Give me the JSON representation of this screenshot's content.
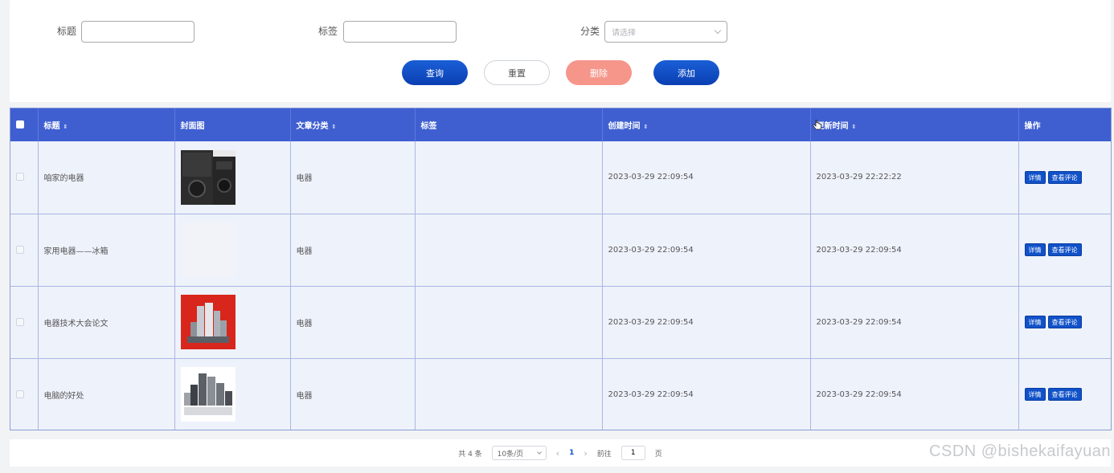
{
  "search": {
    "title_label": "标题",
    "title_value": "",
    "tag_label": "标签",
    "tag_value": "",
    "category_label": "分类",
    "category_placeholder": "请选择",
    "query_button": "查询",
    "reset_button": "重置",
    "delete_button": "删除",
    "add_button": "添加"
  },
  "table": {
    "columns": [
      "标题",
      "封面图",
      "文章分类",
      "标签",
      "创建时间",
      "更新时间",
      "操作"
    ],
    "rows": [
      {
        "title": "咱家的电器",
        "category": "电器",
        "tag": "",
        "created": "2023-03-29 22:09:54",
        "updated": "2023-03-29 22:22:22",
        "cover": "dark-appliance"
      },
      {
        "title": "家用电器——冰箱",
        "category": "电器",
        "tag": "",
        "created": "2023-03-29 22:09:54",
        "updated": "2023-03-29 22:09:54",
        "cover": "blank"
      },
      {
        "title": "电器技术大会论文",
        "category": "电器",
        "tag": "",
        "created": "2023-03-29 22:09:54",
        "updated": "2023-03-29 22:09:54",
        "cover": "red-appliances"
      },
      {
        "title": "电脑的好处",
        "category": "电器",
        "tag": "",
        "created": "2023-03-29 22:09:54",
        "updated": "2023-03-29 22:09:54",
        "cover": "grey-appliances"
      }
    ],
    "detail_button": "详情",
    "comments_button": "查看评论"
  },
  "pagination": {
    "total": "共 4 条",
    "page_size": "10条/页",
    "prev": "‹",
    "current_page": "1",
    "next": "›",
    "goto_label": "前往",
    "goto_value": "1",
    "page_suffix": "页"
  },
  "watermark": "CSDN @bishekaifayuan",
  "colors": {
    "header_blue": "#3f5fd1",
    "primary_button": "#1152c9",
    "danger_button": "#f6968b"
  }
}
